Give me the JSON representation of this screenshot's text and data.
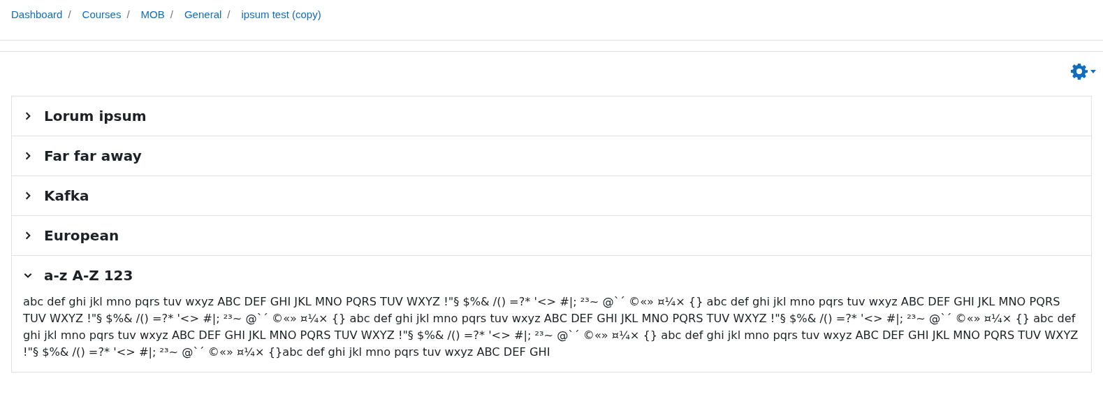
{
  "breadcrumb_separator": "/",
  "breadcrumb": [
    {
      "label": "Dashboard"
    },
    {
      "label": "Courses"
    },
    {
      "label": "MOB"
    },
    {
      "label": "General"
    },
    {
      "label": "ipsum test (copy)"
    }
  ],
  "sections": [
    {
      "title": "Lorum ipsum",
      "expanded": false
    },
    {
      "title": "Far far away",
      "expanded": false
    },
    {
      "title": "Kafka",
      "expanded": false
    },
    {
      "title": "European",
      "expanded": false
    },
    {
      "title": "a-z A-Z 123",
      "expanded": true,
      "content": "abc def ghi jkl mno pqrs tuv wxyz ABC DEF GHI JKL MNO PQRS TUV WXYZ !\"§ $%& /() =?* '<> #|; ²³~ @`´ ©«» ¤¼× {} abc def ghi jkl mno pqrs tuv wxyz ABC DEF GHI JKL MNO PQRS TUV WXYZ !\"§ $%& /() =?* '<> #|; ²³~ @`´ ©«» ¤¼× {} abc def ghi jkl mno pqrs tuv wxyz ABC DEF GHI JKL MNO PQRS TUV WXYZ !\"§ $%& /() =?* '<> #|; ²³~ @`´ ©«» ¤¼× {} abc def ghi jkl mno pqrs tuv wxyz ABC DEF GHI JKL MNO PQRS TUV WXYZ !\"§ $%& /() =?* '<> #|; ²³~ @`´ ©«» ¤¼× {} abc def ghi jkl mno pqrs tuv wxyz ABC DEF GHI JKL MNO PQRS TUV WXYZ !\"§ $%& /() =?* '<> #|; ²³~ @`´ ©«» ¤¼× {}abc def ghi jkl mno pqrs tuv wxyz ABC DEF GHI"
    }
  ]
}
